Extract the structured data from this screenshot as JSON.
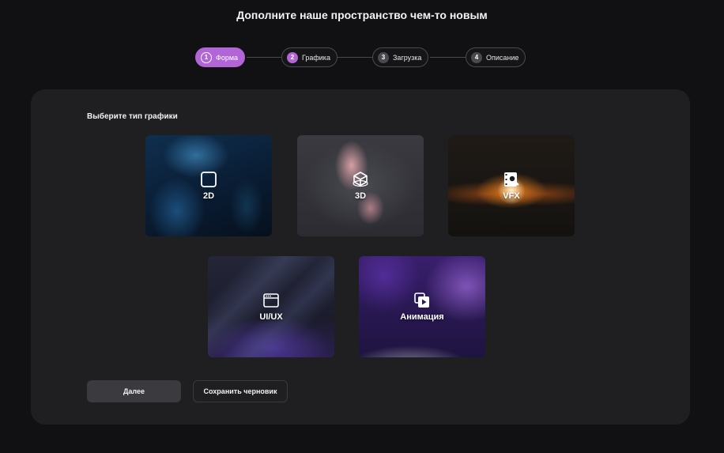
{
  "header": {
    "title": "Дополните наше пространство чем-то новым"
  },
  "stepper": {
    "steps": [
      {
        "num": "1",
        "label": "Форма",
        "active": true
      },
      {
        "num": "2",
        "label": "Графика",
        "active": false
      },
      {
        "num": "3",
        "label": "Загрузка",
        "active": false
      },
      {
        "num": "4",
        "label": "Описание",
        "active": false
      }
    ]
  },
  "main": {
    "section_label": "Выберите тип графики",
    "cards": [
      {
        "label": "2D",
        "icon": "square-icon"
      },
      {
        "label": "3D",
        "icon": "cube-icon"
      },
      {
        "label": "VFX",
        "icon": "film-search-icon"
      },
      {
        "label": "UI/UX",
        "icon": "browser-window-icon"
      },
      {
        "label": "Анимация",
        "icon": "play-layers-icon"
      }
    ],
    "buttons": {
      "next": "Далее",
      "save_draft": "Сохранить черновик"
    }
  },
  "colors": {
    "accent": "#b165d6",
    "panel": "#1f1f21",
    "background": "#111113"
  }
}
